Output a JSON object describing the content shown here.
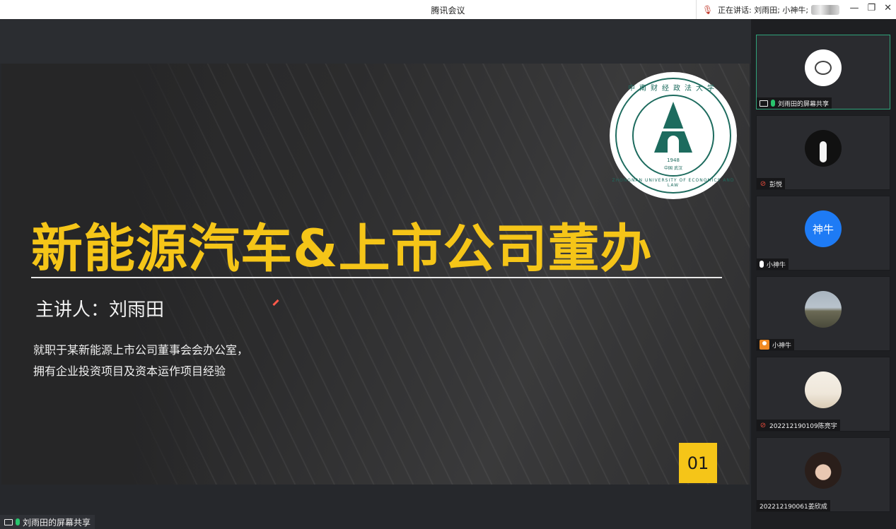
{
  "window": {
    "title": "腾讯会议",
    "speaking_label": "正在讲话: 刘雨田; 小神牛;",
    "controls": {
      "minimize": "—",
      "restore": "❐",
      "close": "✕"
    }
  },
  "share": {
    "owner_label": "刘雨田的屏幕共享",
    "slide": {
      "headline": "新能源汽车&上市公司董办",
      "speaker": "主讲人：刘雨田",
      "description_line1": "就职于某新能源上市公司董事会会办公室，",
      "description_line2": "拥有企业投资项目及资本运作项目经验",
      "page_number": "01",
      "logo": {
        "year": "1948",
        "city": "中国 武汉",
        "arc_text": "中南财经政法大学",
        "english": "ZHONGNAN UNIVERSITY OF ECONOMICS AND LAW"
      }
    }
  },
  "participants": [
    {
      "name": "刘雨田的屏幕共享",
      "avatar": "camera-icon",
      "mic": "on"
    },
    {
      "name": "彭悦",
      "avatar": "goose-avatar",
      "mic": "muted"
    },
    {
      "name": "小神牛",
      "avatar_text": "神牛",
      "mic": "on-white"
    },
    {
      "name": "小神牛",
      "avatar": "mountain-avatar",
      "mic": "person"
    },
    {
      "name": "202212190109陈亮宇",
      "avatar": "anime-avatar",
      "mic": "muted"
    },
    {
      "name": "202212190061姜欣成",
      "avatar": "girl-avatar",
      "mic": "none"
    }
  ],
  "colors": {
    "accent_yellow": "#f5c518",
    "logo_green": "#1d6b5e",
    "active_border": "#2fa37a",
    "avatar_blue": "#1e7bf5"
  }
}
